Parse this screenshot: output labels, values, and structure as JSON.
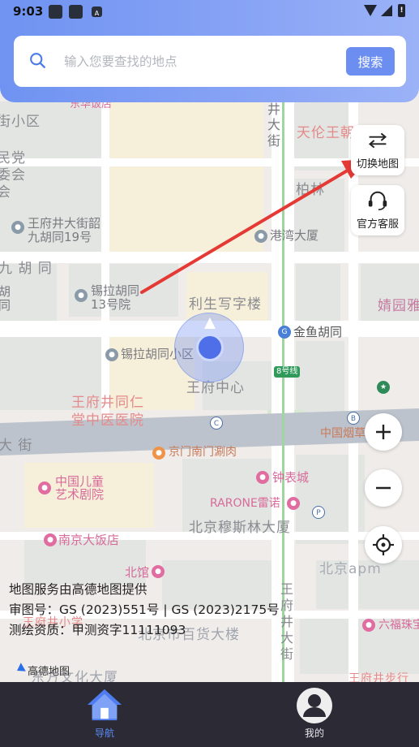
{
  "status_bar": {
    "time": "9:03",
    "notif_icon_letter": "A",
    "battery_text": "!"
  },
  "search": {
    "placeholder": "输入您要查找的地点",
    "button_label": "搜索"
  },
  "tools": {
    "switch_map_label": "切换地图",
    "customer_service_label": "官方客服"
  },
  "map_labels": {
    "l1": "东华饭店",
    "l2": "街小区",
    "l3": "天伦王朝",
    "l4": "井",
    "l5": "大",
    "l6": "街",
    "l7": "民党",
    "l8": "委会",
    "l9": "会",
    "l10": "王府井大街韶",
    "l11": "九胡同19号",
    "l12": "柏林",
    "l13": "港湾大厦",
    "l14": "九 胡 同",
    "l15": "胡",
    "l16": "同",
    "l17": "锡拉胡同",
    "l18": "13号院",
    "l19": "利生写字楼",
    "l20": "婧园雅",
    "l21": "金鱼胡同",
    "l22": "锡拉胡同小区",
    "l23": "8号线",
    "l24": "王府中心",
    "l25": "王府井同仁",
    "l26": "堂中医医院",
    "l27": "中国烟草",
    "l28": "大 街",
    "l29": "京门南门涮肉",
    "l30": "中国儿童",
    "l31": "艺术剧院",
    "l32": "钟表城",
    "l33": "RARONE雷诺",
    "l34": "南京大饭店",
    "l35": "北京穆斯林大厦",
    "l36": "北馆",
    "l37": "北京apm",
    "l38": "王府井小学",
    "l39": "北京市百货大楼",
    "l40": "六福珠宝",
    "l41": "东方文化大厦",
    "l42": "王府井步行",
    "v_street": "王府井大街"
  },
  "attribution": {
    "line1": "地图服务由高德地图提供",
    "line2": "审图号：GS (2023)551号 | GS (2023)2175号",
    "line3": "测绘资质：甲测资字11111093"
  },
  "amap_logo_text": "高德地图",
  "nav": {
    "home_label": "导航",
    "mine_label": "我的"
  },
  "colors": {
    "accent": "#6b8ef0",
    "nav_bg": "#2b2a35",
    "annotation_arrow": "#e53935"
  }
}
